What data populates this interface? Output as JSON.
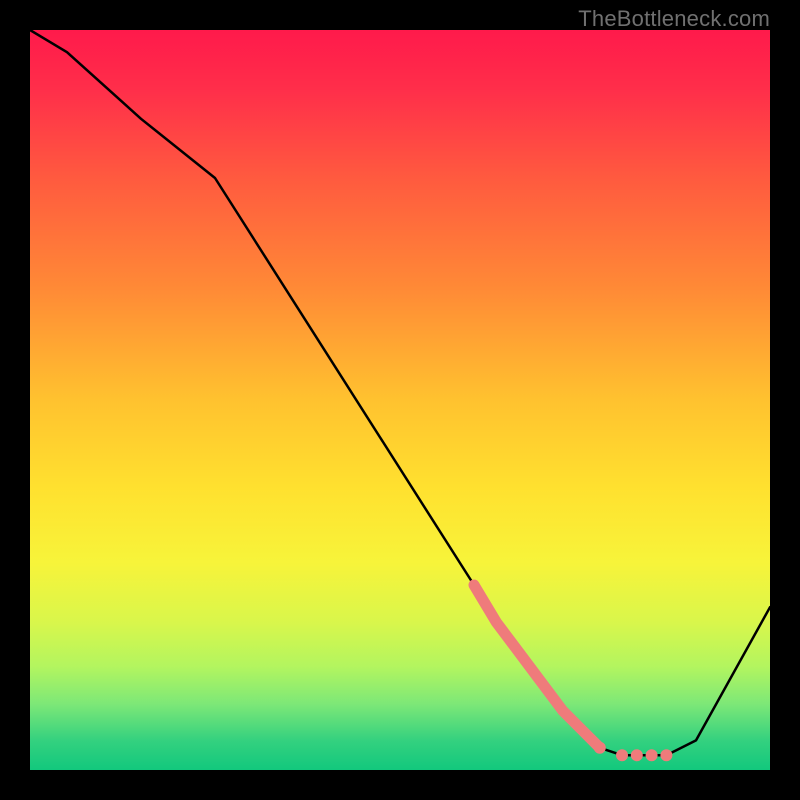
{
  "watermark": "TheBottleneck.com",
  "chart_data": {
    "type": "line",
    "title": "",
    "xlabel": "",
    "ylabel": "",
    "xlim": [
      0,
      100
    ],
    "ylim": [
      0,
      100
    ],
    "curve": {
      "name": "bottleneck-curve",
      "x": [
        0,
        5,
        15,
        25,
        60,
        70,
        77,
        80,
        86,
        90,
        100
      ],
      "y": [
        100,
        97,
        88,
        80,
        25,
        10,
        3,
        2,
        2,
        4,
        22
      ]
    },
    "highlight_segment": {
      "name": "highlighted-range",
      "color": "#ef7b7b",
      "x": [
        60,
        63,
        66,
        69,
        72,
        75,
        77
      ],
      "y": [
        25,
        20,
        16,
        12,
        8,
        5,
        3
      ]
    },
    "highlight_points": {
      "name": "highlight-dots",
      "color": "#ef7b7b",
      "points": [
        {
          "x": 77,
          "y": 3
        },
        {
          "x": 80,
          "y": 2
        },
        {
          "x": 82,
          "y": 2
        },
        {
          "x": 84,
          "y": 2
        },
        {
          "x": 86,
          "y": 2
        }
      ]
    },
    "gradient_stops": [
      {
        "offset": 0,
        "color": "#ff1a4b"
      },
      {
        "offset": 0.08,
        "color": "#ff2e4a"
      },
      {
        "offset": 0.2,
        "color": "#ff5a3f"
      },
      {
        "offset": 0.35,
        "color": "#ff8a36"
      },
      {
        "offset": 0.5,
        "color": "#ffc22f"
      },
      {
        "offset": 0.62,
        "color": "#ffe12f"
      },
      {
        "offset": 0.72,
        "color": "#f7f43a"
      },
      {
        "offset": 0.8,
        "color": "#d9f64b"
      },
      {
        "offset": 0.86,
        "color": "#b3f55f"
      },
      {
        "offset": 0.91,
        "color": "#7ee877"
      },
      {
        "offset": 0.96,
        "color": "#34d17f"
      },
      {
        "offset": 1.0,
        "color": "#12c87d"
      }
    ]
  }
}
